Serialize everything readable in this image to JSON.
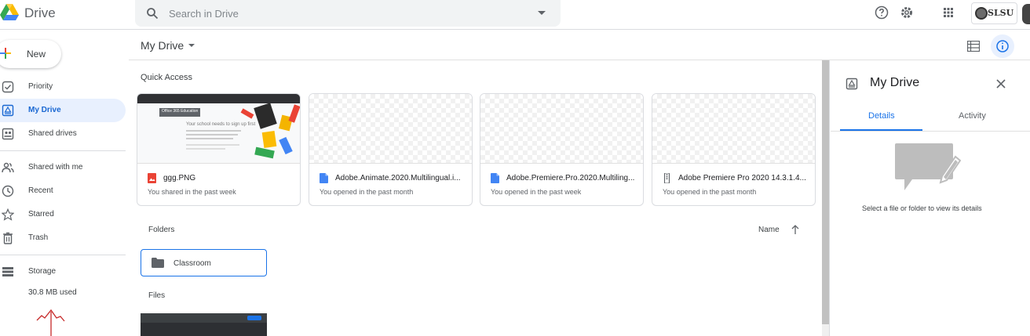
{
  "header": {
    "app_name": "Drive",
    "search_placeholder": "Search in Drive",
    "icons": [
      "drive-logo-icon",
      "search-icon",
      "dropdown-icon",
      "help-icon",
      "settings-icon",
      "apps-grid-icon"
    ],
    "account_org": "SLSU"
  },
  "toolbar": {
    "breadcrumb": "My Drive"
  },
  "sidebar": {
    "new_label": "New",
    "items": [
      {
        "label": "Priority",
        "icon": "priority-icon"
      },
      {
        "label": "My Drive",
        "icon": "my-drive-icon",
        "active": true
      },
      {
        "label": "Shared drives",
        "icon": "shared-drives-icon"
      },
      {
        "label": "Shared with me",
        "icon": "shared-with-me-icon"
      },
      {
        "label": "Recent",
        "icon": "clock-icon"
      },
      {
        "label": "Starred",
        "icon": "star-icon"
      },
      {
        "label": "Trash",
        "icon": "trash-icon"
      },
      {
        "label": "Storage",
        "icon": "storage-icon"
      }
    ],
    "storage_used": "30.8 MB used"
  },
  "main": {
    "quick_access_label": "Quick Access",
    "quick_access": [
      {
        "name": "ggg.PNG",
        "subtitle": "You shared in the past week",
        "icon": "image-file-icon"
      },
      {
        "name": "Adobe.Animate.2020.Multilingual.i...",
        "subtitle": "You opened in the past month",
        "icon": "doc-file-icon"
      },
      {
        "name": "Adobe.Premiere.Pro.2020.Multiling...",
        "subtitle": "You opened in the past week",
        "icon": "doc-file-icon"
      },
      {
        "name": "Adobe Premiere Pro 2020 14.3.1.4...",
        "subtitle": "You opened in the past month",
        "icon": "archive-file-icon"
      }
    ],
    "thumb_text": {
      "tab": "Office 365 Education",
      "heading": "Your school needs to sign up first"
    },
    "folders_label": "Folders",
    "sort_label": "Name",
    "folders": [
      {
        "name": "Classroom"
      }
    ],
    "files_label": "Files"
  },
  "details_panel": {
    "title": "My Drive",
    "tabs": [
      "Details",
      "Activity"
    ],
    "empty_message": "Select a file or folder to view its details"
  },
  "colors": {
    "accent": "#1a73e8",
    "active_bg": "#e8f0fe",
    "annotation": "#c62828"
  }
}
